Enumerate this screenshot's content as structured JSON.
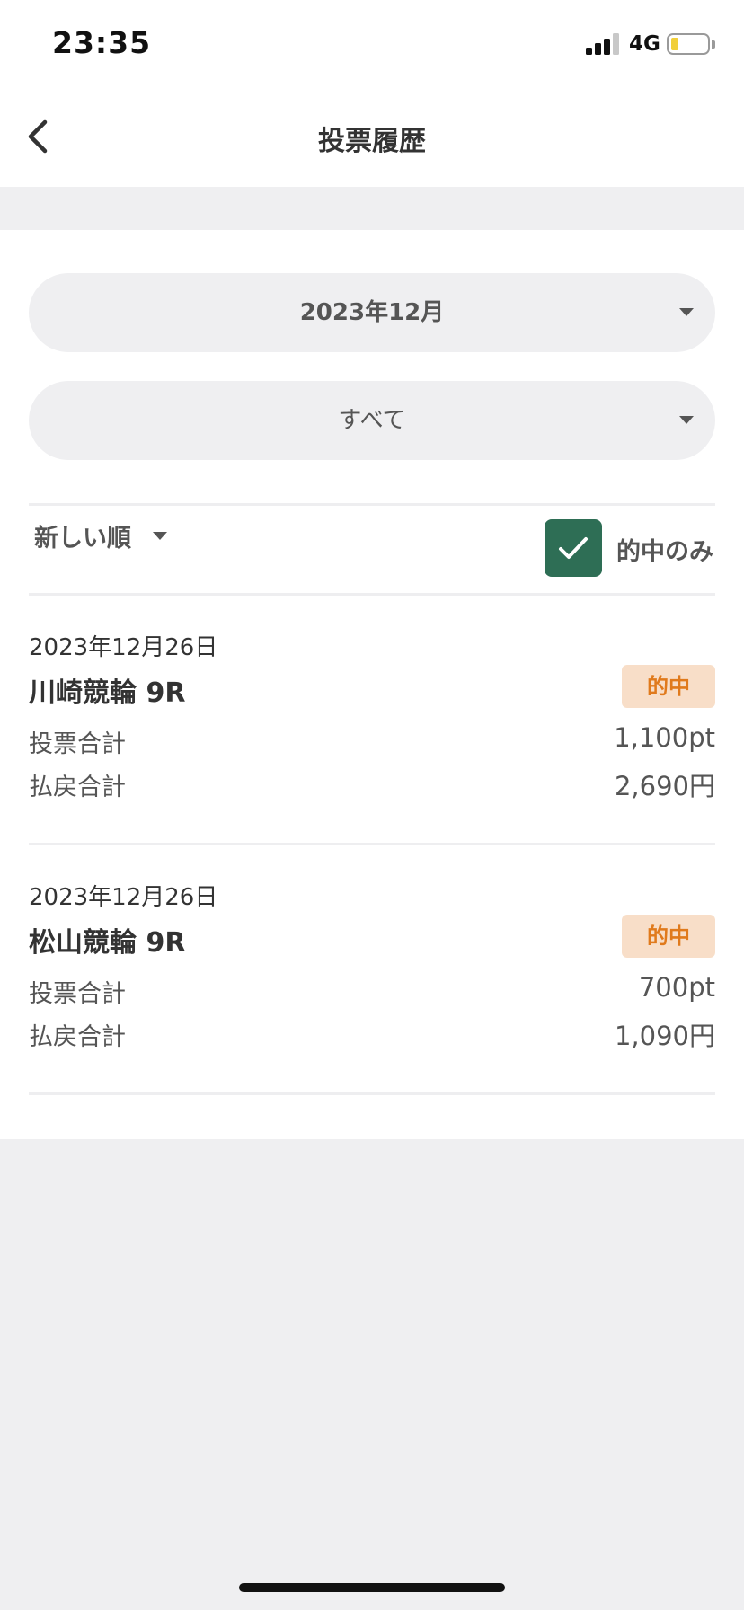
{
  "status_bar": {
    "time": "23:35",
    "network": "4G"
  },
  "nav": {
    "title": "投票履歴",
    "back_icon": "chevron-left-icon"
  },
  "filters": {
    "month": "2023年12月",
    "type": "すべて"
  },
  "toolbar": {
    "sort_label": "新しい順",
    "hit_only_label": "的中のみ",
    "hit_only_checked": true
  },
  "records": [
    {
      "date": "2023年12月26日",
      "race": "川崎競輪 9R",
      "badge": "的中",
      "bet_label": "投票合計",
      "bet_value": "1,100pt",
      "payout_label": "払戻合計",
      "payout_value": "2,690円"
    },
    {
      "date": "2023年12月26日",
      "race": "松山競輪 9R",
      "badge": "的中",
      "bet_label": "投票合計",
      "bet_value": "700pt",
      "payout_label": "払戻合計",
      "payout_value": "1,090円"
    }
  ],
  "colors": {
    "accent_green": "#2e6e55",
    "badge_bg": "#f8dec8",
    "badge_text": "#e07a1c"
  }
}
